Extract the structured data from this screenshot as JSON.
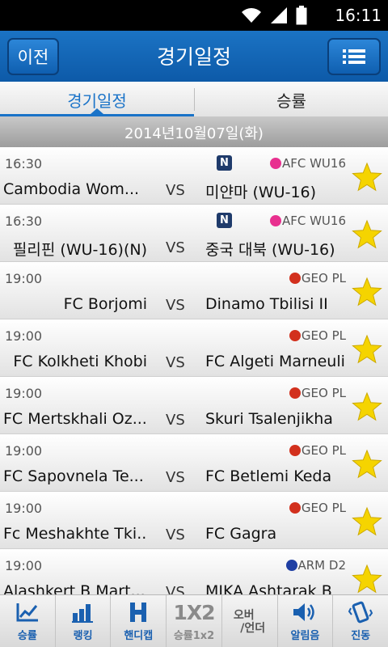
{
  "status": {
    "time": "16:11"
  },
  "header": {
    "back_label": "이전",
    "title": "경기일정"
  },
  "tabs": [
    {
      "label": "경기일정"
    },
    {
      "label": "승률"
    }
  ],
  "date_label": "2014년10월07일(화)",
  "colors": {
    "accent": "#1a73c8",
    "afc": "#e8308f",
    "geo": "#d2301d",
    "arm": "#1f3fa3",
    "star": "#f5d400"
  },
  "matches": [
    {
      "time": "16:30",
      "home": "Cambodia Wom...",
      "home_align": "left",
      "vs": "VS",
      "away": "미얀마 (WU-16)",
      "new_badge": "N",
      "league": "AFC WU16",
      "league_color": "#e8308f"
    },
    {
      "time": "16:30",
      "home": "필리핀 (WU-16)(N)",
      "home_align": "right",
      "vs": "VS",
      "away": "중국 대북 (WU-16)",
      "new_badge": "N",
      "league": "AFC WU16",
      "league_color": "#e8308f"
    },
    {
      "time": "19:00",
      "home": "FC Borjomi",
      "home_align": "right",
      "vs": "VS",
      "away": "Dinamo Tbilisi II",
      "new_badge": "",
      "league": "GEO PL",
      "league_color": "#d2301d"
    },
    {
      "time": "19:00",
      "home": "FC Kolkheti Khobi",
      "home_align": "right",
      "vs": "VS",
      "away": "FC Algeti Marneuli",
      "new_badge": "",
      "league": "GEO PL",
      "league_color": "#d2301d"
    },
    {
      "time": "19:00",
      "home": "FC Mertskhali Oz...",
      "home_align": "left",
      "vs": "VS",
      "away": "Skuri Tsalenjikha",
      "new_badge": "",
      "league": "GEO PL",
      "league_color": "#d2301d"
    },
    {
      "time": "19:00",
      "home": "FC Sapovnela Te...",
      "home_align": "left",
      "vs": "VS",
      "away": "FC Betlemi Keda",
      "new_badge": "",
      "league": "GEO PL",
      "league_color": "#d2301d"
    },
    {
      "time": "19:00",
      "home": "Fc Meshakhte Tki...",
      "home_align": "left",
      "vs": "VS",
      "away": "FC Gagra",
      "new_badge": "",
      "league": "GEO PL",
      "league_color": "#d2301d"
    },
    {
      "time": "19:00",
      "home": "Alashkert B Mart...",
      "home_align": "left",
      "vs": "VS",
      "away": "MIKA Ashtarak B",
      "new_badge": "",
      "league": "ARM D2",
      "league_color": "#1f3fa3"
    }
  ],
  "bottom_nav": [
    {
      "label": "승률",
      "icon": "line-chart-icon"
    },
    {
      "label": "랭킹",
      "icon": "bar-chart-icon"
    },
    {
      "label": "핸디캡",
      "icon": "h-letter-icon"
    },
    {
      "label": "승률1x2",
      "icon": "1x2-icon",
      "icon_text": "1X2"
    },
    {
      "label": "",
      "icon": "over-under-icon",
      "icon_text_top": "오버",
      "icon_text_bottom": "/언더"
    },
    {
      "label": "알림음",
      "icon": "speaker-icon"
    },
    {
      "label": "진동",
      "icon": "vibrate-icon"
    }
  ]
}
